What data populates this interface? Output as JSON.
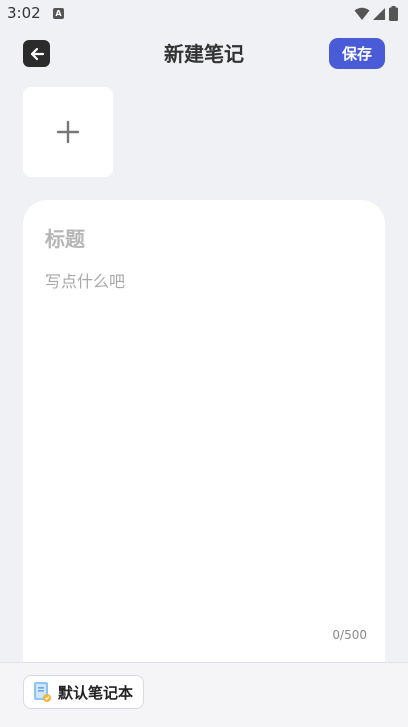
{
  "status_bar": {
    "time": "3:02",
    "notification_letter": "A"
  },
  "header": {
    "title": "新建笔记",
    "save_label": "保存"
  },
  "editor": {
    "title_placeholder": "标题",
    "content_placeholder": "写点什么吧",
    "char_count": "0/500"
  },
  "footer": {
    "notebook_label": "默认笔记本"
  },
  "colors": {
    "accent": "#4a5bd8",
    "background": "#f0f1f4"
  }
}
